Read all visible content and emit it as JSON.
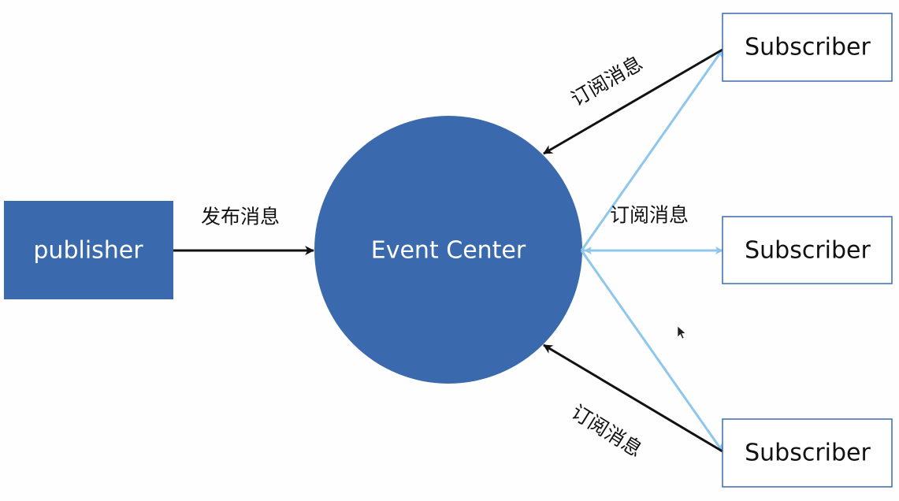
{
  "colors": {
    "node_fill": "#3a6aad",
    "publish_arrow": "#111111",
    "subscribe_arrow": "#111111",
    "notify_line": "#8ec6ec",
    "subscriber_border": "#3a6aad"
  },
  "publisher": {
    "label": "publisher"
  },
  "event_center": {
    "label": "Event Center"
  },
  "subscribers": [
    {
      "label": "Subscriber"
    },
    {
      "label": "Subscriber"
    },
    {
      "label": "Subscriber"
    }
  ],
  "edges": {
    "publish_label": "发布消息",
    "subscribe_labels": [
      "订阅消息",
      "订阅消息",
      "订阅消息"
    ]
  }
}
